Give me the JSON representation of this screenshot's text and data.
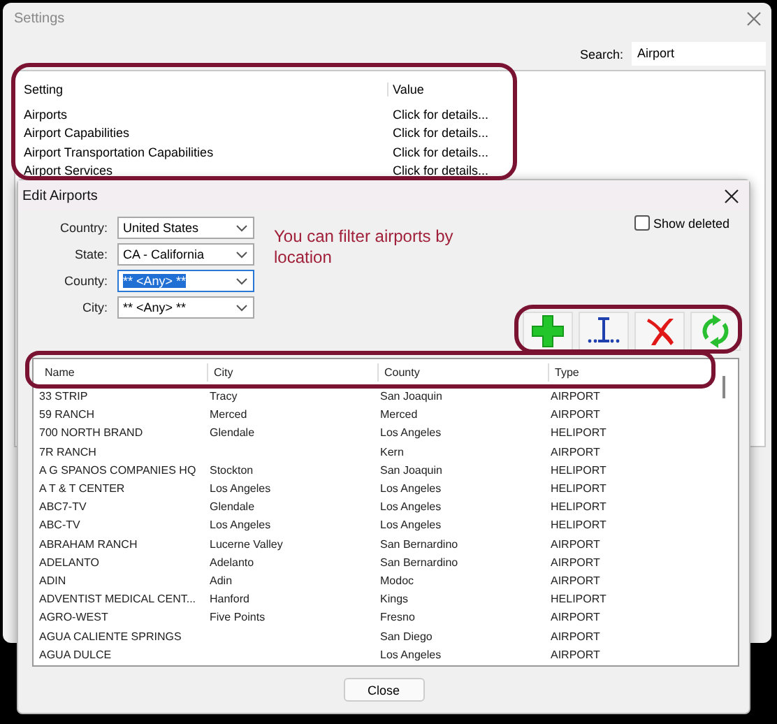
{
  "settings_window": {
    "title": "Settings",
    "search": {
      "label": "Search:",
      "value": "Airport"
    },
    "table": {
      "columns": [
        "Setting",
        "Value"
      ],
      "rows": [
        {
          "setting": "Airports",
          "value": "Click for details..."
        },
        {
          "setting": "Airport Capabilities",
          "value": "Click for details..."
        },
        {
          "setting": "Airport Transportation Capabilities",
          "value": "Click for details..."
        },
        {
          "setting": "Airport Services",
          "value": "Click for details..."
        }
      ]
    }
  },
  "edit_airports": {
    "title": "Edit Airports",
    "filters": [
      {
        "label": "Country:",
        "value": "United States",
        "focused": false
      },
      {
        "label": "State:",
        "value": "CA - California",
        "focused": false
      },
      {
        "label": "County:",
        "value": "** <Any> **",
        "focused": true
      },
      {
        "label": "City:",
        "value": "** <Any> **",
        "focused": false
      }
    ],
    "hint": "You can filter airports by location",
    "show_deleted": {
      "label": "Show deleted",
      "checked": false
    },
    "toolbar": [
      {
        "kind": "add"
      },
      {
        "kind": "edit"
      },
      {
        "kind": "delete"
      },
      {
        "kind": "refresh"
      }
    ],
    "table": {
      "columns": [
        "Name",
        "City",
        "County",
        "Type"
      ],
      "rows": [
        [
          "33 STRIP",
          "Tracy",
          "San Joaquin",
          "AIRPORT"
        ],
        [
          "59 RANCH",
          "Merced",
          "Merced",
          "AIRPORT"
        ],
        [
          "700 NORTH BRAND",
          "Glendale",
          "Los Angeles",
          "HELIPORT"
        ],
        [
          "7R RANCH",
          "",
          "Kern",
          "AIRPORT"
        ],
        [
          "A G SPANOS COMPANIES HQ",
          "Stockton",
          "San Joaquin",
          "HELIPORT"
        ],
        [
          "A T & T CENTER",
          "Los Angeles",
          "Los Angeles",
          "HELIPORT"
        ],
        [
          "ABC7-TV",
          "Glendale",
          "Los Angeles",
          "HELIPORT"
        ],
        [
          "ABC-TV",
          "Los Angeles",
          "Los Angeles",
          "HELIPORT"
        ],
        [
          "ABRAHAM RANCH",
          "Lucerne Valley",
          "San Bernardino",
          "AIRPORT"
        ],
        [
          "ADELANTO",
          "Adelanto",
          "San Bernardino",
          "AIRPORT"
        ],
        [
          "ADIN",
          "Adin",
          "Modoc",
          "AIRPORT"
        ],
        [
          "ADVENTIST MEDICAL CENT...",
          "Hanford",
          "Kings",
          "HELIPORT"
        ],
        [
          "AGRO-WEST",
          "Five Points",
          "Fresno",
          "AIRPORT"
        ],
        [
          "AGUA CALIENTE SPRINGS",
          "",
          "San Diego",
          "AIRPORT"
        ],
        [
          "AGUA DULCE",
          "",
          "Los Angeles",
          "AIRPORT"
        ]
      ]
    },
    "close_button": "Close"
  }
}
